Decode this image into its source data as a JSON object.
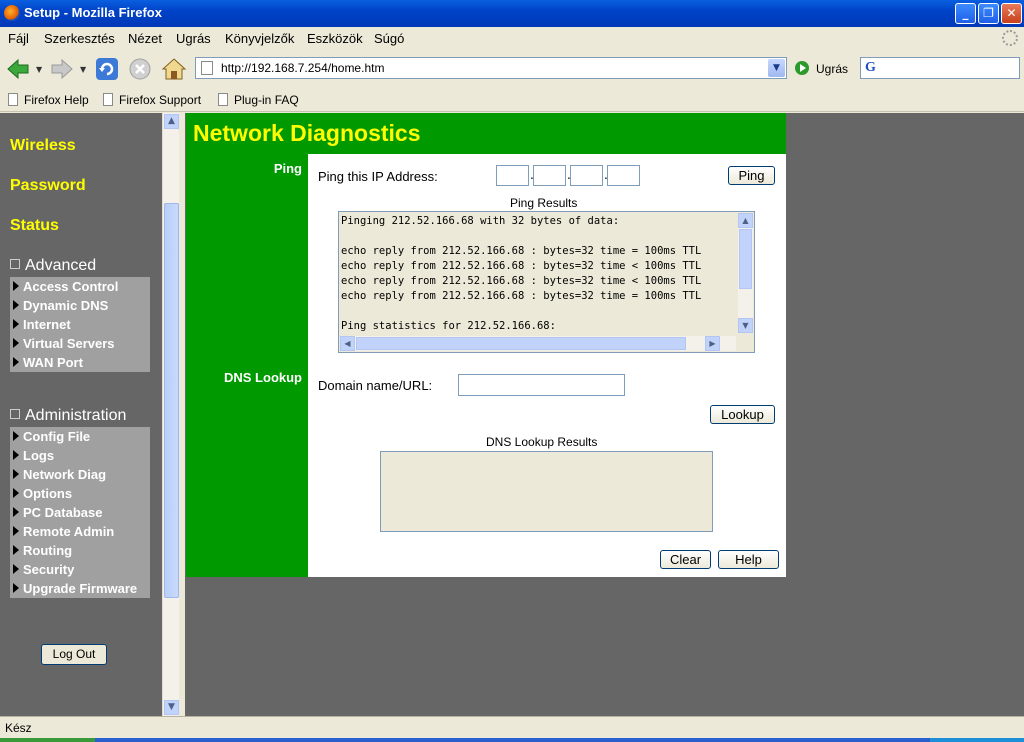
{
  "window": {
    "title": "Setup - Mozilla Firefox"
  },
  "menu": [
    "Fájl",
    "Szerkesztés",
    "Nézet",
    "Ugrás",
    "Könyvjelzők",
    "Eszközök",
    "Súgó"
  ],
  "nav": {
    "url": "http://192.168.7.254/home.htm",
    "go_label": "Ugrás"
  },
  "bookmarks": [
    "Firefox Help",
    "Firefox Support",
    "Plug-in FAQ"
  ],
  "sidebar": {
    "top_links": [
      "Wireless",
      "Password",
      "Status"
    ],
    "advanced": {
      "heading": "Advanced",
      "items": [
        "Access Control",
        "Dynamic DNS",
        "Internet",
        "Virtual Servers",
        "WAN Port"
      ]
    },
    "administration": {
      "heading": "Administration",
      "items": [
        "Config File",
        "Logs",
        "Network Diag",
        "Options",
        "PC Database",
        "Remote Admin",
        "Routing",
        "Security",
        "Upgrade Firmware"
      ]
    },
    "logout_label": "Log Out"
  },
  "main": {
    "title": "Network Diagnostics",
    "ping": {
      "section_label": "Ping",
      "field_label": "Ping this IP Address:",
      "button_label": "Ping",
      "results_label": "Ping Results",
      "results_lines": [
        "Pinging 212.52.166.68 with 32 bytes of data:",
        "",
        "echo reply from 212.52.166.68 : bytes=32 time = 100ms TTL",
        "echo reply from 212.52.166.68 : bytes=32 time < 100ms TTL",
        "echo reply from 212.52.166.68 : bytes=32 time < 100ms TTL",
        "echo reply from 212.52.166.68 : bytes=32 time = 100ms TTL",
        "",
        "Ping statistics for 212.52.166.68:"
      ]
    },
    "dns": {
      "section_label": "DNS Lookup",
      "field_label": "Domain name/URL:",
      "button_label": "Lookup",
      "results_label": "DNS Lookup Results"
    },
    "clear_label": "Clear",
    "help_label": "Help"
  },
  "status": {
    "text": "Kész"
  }
}
